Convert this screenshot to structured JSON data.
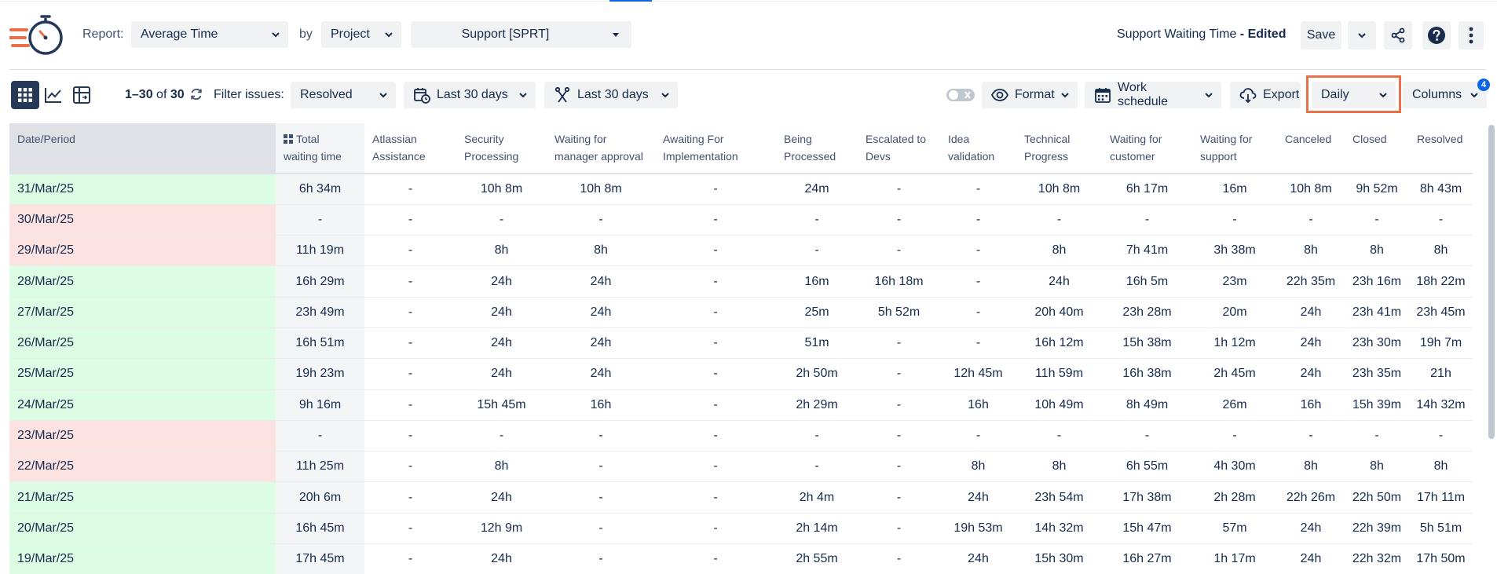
{
  "header": {
    "report_label": "Report:",
    "report_value": "Average Time",
    "by_label": "by",
    "by_value": "Project",
    "project_value": "Support [SPRT]",
    "report_title": "Support Waiting Time",
    "edited_suffix": " - Edited",
    "save_label": "Save"
  },
  "toolbar": {
    "range_count": "1–30",
    "of_label": "of",
    "total_count": "30",
    "filter_label": "Filter issues:",
    "filter_value": "Resolved",
    "date_range_1": "Last 30 days",
    "date_range_2": "Last 30 days",
    "format_label": "Format",
    "work_schedule_label": "Work schedule",
    "export_label": "Export",
    "period_value": "Daily",
    "columns_label": "Columns",
    "columns_badge": "4"
  },
  "table": {
    "headers": [
      [
        "Date/Period"
      ],
      [
        "Total",
        "waiting time"
      ],
      [
        "Atlassian",
        "Assistance"
      ],
      [
        "Security",
        "Processing"
      ],
      [
        "Waiting for",
        "manager approval"
      ],
      [
        "Awaiting For",
        "Implementation"
      ],
      [
        "Being",
        "Processed"
      ],
      [
        "Escalated to",
        "Devs"
      ],
      [
        "Idea",
        "validation"
      ],
      [
        "Technical",
        "Progress"
      ],
      [
        "Waiting for",
        "customer"
      ],
      [
        "Waiting for",
        "support"
      ],
      [
        "Canceled"
      ],
      [
        "Closed"
      ],
      [
        "Resolved"
      ]
    ],
    "rows": [
      {
        "date": "31/Mar/25",
        "status": "ok",
        "cells": [
          "6h 34m",
          "-",
          "10h 8m",
          "10h 8m",
          "-",
          "24m",
          "-",
          "-",
          "10h 8m",
          "6h 17m",
          "16m",
          "10h 8m",
          "9h 52m",
          "8h 43m"
        ]
      },
      {
        "date": "30/Mar/25",
        "status": "no",
        "cells": [
          "-",
          "-",
          "-",
          "-",
          "-",
          "-",
          "-",
          "-",
          "-",
          "-",
          "-",
          "-",
          "-",
          "-"
        ]
      },
      {
        "date": "29/Mar/25",
        "status": "no",
        "cells": [
          "11h 19m",
          "-",
          "8h",
          "8h",
          "-",
          "-",
          "-",
          "-",
          "8h",
          "7h 41m",
          "3h 38m",
          "8h",
          "8h",
          "8h"
        ]
      },
      {
        "date": "28/Mar/25",
        "status": "ok",
        "cells": [
          "16h 29m",
          "-",
          "24h",
          "24h",
          "-",
          "16m",
          "16h 18m",
          "-",
          "24h",
          "16h 5m",
          "23m",
          "22h 35m",
          "23h 16m",
          "18h 22m"
        ]
      },
      {
        "date": "27/Mar/25",
        "status": "ok",
        "cells": [
          "23h 49m",
          "-",
          "24h",
          "24h",
          "-",
          "25m",
          "5h 52m",
          "-",
          "20h 40m",
          "23h 28m",
          "20m",
          "24h",
          "23h 41m",
          "23h 45m"
        ]
      },
      {
        "date": "26/Mar/25",
        "status": "ok",
        "cells": [
          "16h 51m",
          "-",
          "24h",
          "24h",
          "-",
          "51m",
          "-",
          "-",
          "16h 12m",
          "15h 38m",
          "1h 12m",
          "24h",
          "23h 30m",
          "19h 7m"
        ]
      },
      {
        "date": "25/Mar/25",
        "status": "ok",
        "cells": [
          "19h 23m",
          "-",
          "24h",
          "24h",
          "-",
          "2h 50m",
          "-",
          "12h 45m",
          "11h 59m",
          "16h 38m",
          "2h 45m",
          "24h",
          "23h 35m",
          "21h"
        ]
      },
      {
        "date": "24/Mar/25",
        "status": "ok",
        "cells": [
          "9h 16m",
          "-",
          "15h 45m",
          "16h",
          "-",
          "2h 29m",
          "-",
          "16h",
          "10h 49m",
          "8h 49m",
          "26m",
          "16h",
          "15h 39m",
          "14h 32m"
        ]
      },
      {
        "date": "23/Mar/25",
        "status": "no",
        "cells": [
          "-",
          "-",
          "-",
          "-",
          "-",
          "-",
          "-",
          "-",
          "-",
          "-",
          "-",
          "-",
          "-",
          "-"
        ]
      },
      {
        "date": "22/Mar/25",
        "status": "no",
        "cells": [
          "11h 25m",
          "-",
          "8h",
          "-",
          "-",
          "-",
          "-",
          "8h",
          "8h",
          "6h 55m",
          "4h 30m",
          "8h",
          "8h",
          "8h"
        ]
      },
      {
        "date": "21/Mar/25",
        "status": "ok",
        "cells": [
          "20h 6m",
          "-",
          "24h",
          "-",
          "-",
          "2h 4m",
          "-",
          "24h",
          "23h 54m",
          "17h 38m",
          "2h 28m",
          "22h 26m",
          "22h 50m",
          "17h 11m"
        ]
      },
      {
        "date": "20/Mar/25",
        "status": "ok",
        "cells": [
          "16h 45m",
          "-",
          "12h 9m",
          "-",
          "-",
          "2h 14m",
          "-",
          "19h 53m",
          "14h 32m",
          "15h 47m",
          "57m",
          "24h",
          "22h 39m",
          "5h 51m"
        ]
      },
      {
        "date": "19/Mar/25",
        "status": "ok",
        "cells": [
          "17h 45m",
          "-",
          "24h",
          "-",
          "-",
          "2h 55m",
          "-",
          "24h",
          "15h 30m",
          "16h 27m",
          "1h 17m",
          "24h",
          "22h 32m",
          "17h 50m"
        ]
      }
    ]
  },
  "icons": {
    "logo": "stopwatch-logo-icon",
    "share": "share-icon",
    "help": "help-icon",
    "more": "more-vertical-icon",
    "grid": "grid-view-icon",
    "chart": "chart-view-icon",
    "pivot": "pivot-view-icon",
    "refresh": "refresh-icon",
    "calendar_clock": "calendar-clock-icon",
    "transition": "transition-icon",
    "toggle": "toggle-icon",
    "eye": "eye-icon",
    "calendar": "calendar-icon",
    "cloud_download": "cloud-download-icon"
  },
  "colors": {
    "accent": "#0c66e4",
    "highlight": "#e8714a",
    "row_ok": "#dcfce3",
    "row_no": "#fde2e2",
    "logo_orange": "#e8714a",
    "logo_navy": "#253858"
  }
}
